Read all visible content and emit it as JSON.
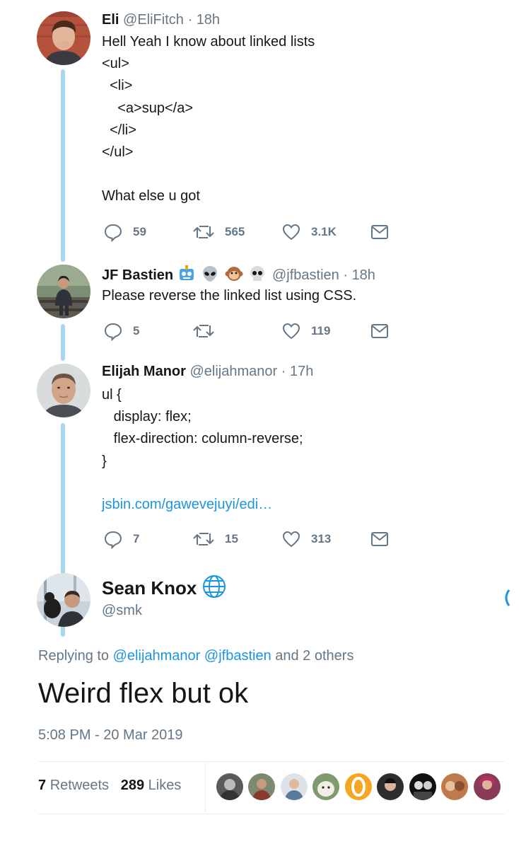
{
  "tweets": [
    {
      "name": "Eli",
      "handle": "@EliFitch",
      "time": "18h",
      "body": "Hell Yeah I know about linked lists\n<ul>\n  <li>\n    <a>sup</a>\n  </li>\n</ul>\n\nWhat else u got",
      "replies": "59",
      "retweets": "565",
      "likes": "3.1K"
    },
    {
      "name": "JF Bastien",
      "emojis": [
        "robot-emoji",
        "alien-emoji",
        "monkey-emoji",
        "skull-emoji"
      ],
      "handle": "@jfbastien",
      "time": "18h",
      "body": "Please reverse the linked list using CSS.",
      "replies": "5",
      "retweets": "",
      "likes": "119"
    },
    {
      "name": "Elijah Manor",
      "handle": "@elijahmanor",
      "time": "17h",
      "body": "ul {\n   display: flex;\n   flex-direction: column-reverse;\n}",
      "link": "jsbin.com/gawevejuyi/edi…",
      "replies": "7",
      "retweets": "15",
      "likes": "313"
    }
  ],
  "main_tweet": {
    "name": "Sean Knox",
    "handle": "@smk",
    "replying_prefix": "Replying to",
    "replying_user1": "@elijahmanor",
    "replying_user2": "@jfbastien",
    "replying_suffix": "and 2 others",
    "text": "Weird flex but ok",
    "timestamp": "5:08 PM - 20 Mar 2019",
    "retweets_count": "7",
    "retweets_label": "Retweets",
    "likes_count": "289",
    "likes_label": "Likes",
    "liker_avatars": 10
  },
  "colors": {
    "thread_line": "#a9d5ee",
    "link": "#1b95e0",
    "muted": "#657786",
    "text": "#14171a"
  },
  "separator": "·"
}
